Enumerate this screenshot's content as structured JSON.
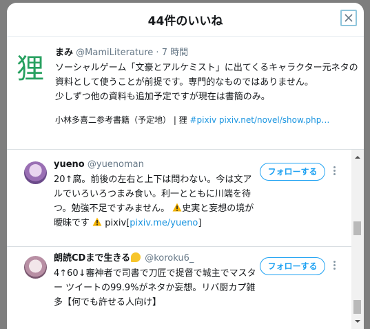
{
  "modal": {
    "title": "44件のいいね",
    "close_icon": "close-icon"
  },
  "quote": {
    "logo_text": "狸",
    "name": "まみ",
    "handle": "@MamiLiterature",
    "separator": " · ",
    "time": "7 時間",
    "text": "ソーシャルゲーム「文豪とアルケミスト」に出てくるキャラクター元ネタの資料として使うことが前提です。専門的なものではありません。\n少しずつ他の資料も追加予定ですが現在は書簡のみ。",
    "bio_prefix": "小林多喜二参考書籍（予定地） | 狸 ",
    "bio_link": "#pixiv pixiv.net/novel/show.php…"
  },
  "users": [
    {
      "name": "yueno",
      "handle": "@yuenoman",
      "bio_main": "20↑腐。前後の左右と上下は問わない。今は文アルでいろいろつまみ食い。利一とともに川端を待つ。勉強不足ですみません。",
      "bio_warn1": "史実と妄想の境が曖昧です",
      "bio_warn2_prefix": "pixiv[",
      "bio_link": "pixiv.me/yueno",
      "bio_warn2_suffix": "]",
      "follow_label": "フォローする"
    },
    {
      "name": "朗読CDまで生きる",
      "handle": "@koroku6_",
      "bio": "4↑60↓審神者で司書で刀匠で提督で城主でマスター ツイートの99.9%がネタか妄想。リバ厨カプ雑多【何でも許せる人向け】",
      "follow_label": "フォローする"
    }
  ],
  "colors": {
    "accent": "#1da1f2",
    "link": "#1b95e0",
    "overlay": "#7e7e7e"
  }
}
